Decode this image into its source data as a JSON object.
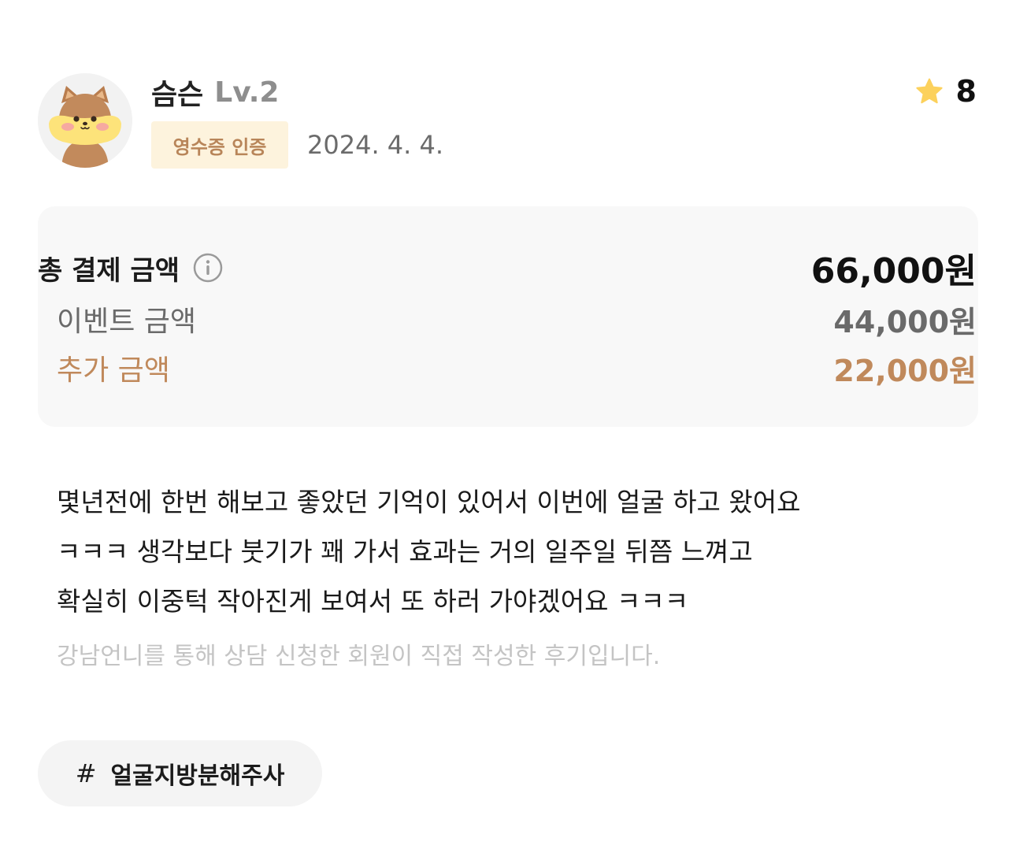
{
  "review": {
    "user": {
      "name": "슴슨",
      "level": "Lv.2",
      "avatar": "squirrel-avatar"
    },
    "verification_badge": "영수증 인증",
    "date": "2024. 4. 4.",
    "rating": {
      "icon": "star-icon",
      "value": "8",
      "color": "#fcd15c"
    },
    "pricing": {
      "total_label": "총 결제 금액",
      "total_value": "66,000원",
      "event_label": "이벤트 금액",
      "event_value": "44,000원",
      "extra_label": "추가 금액",
      "extra_value": "22,000원",
      "accent_color": "#c0895b"
    },
    "content_lines": [
      "몇년전에 한번 해보고 좋았던 기억이 있어서 이번에 얼굴 하고 왔어요",
      "ㅋㅋㅋ 생각보다 붓기가 꽤 가서 효과는 거의 일주일 뒤쯤 느껴고",
      "확실히 이중턱 작아진게 보여서 또 하러 가야겠어요 ㅋㅋㅋ"
    ],
    "disclaimer": "강남언니를 통해 상담 신청한 회원이 직접 작성한 후기입니다.",
    "tag": {
      "hash": "#",
      "label": "얼굴지방분해주사"
    }
  }
}
